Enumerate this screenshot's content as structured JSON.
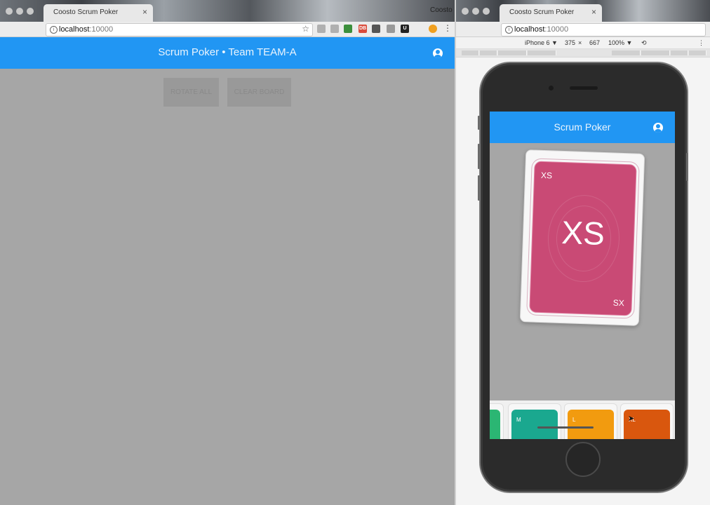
{
  "left_window": {
    "tab_title": "Coosto Scrum Poker",
    "profile_name": "Coosto",
    "url_host": "localhost",
    "url_port": ":10000",
    "app_title": "Scrum Poker • Team TEAM-A",
    "buttons": {
      "rotate_all": "ROTATE ALL",
      "clear_board": "CLEAR BOARD"
    },
    "extensions": [
      "DB",
      "U"
    ]
  },
  "right_window": {
    "tab_title": "Coosto Scrum Poker",
    "url_host": "localhost",
    "url_port": ":10000",
    "device_bar": {
      "device": "iPhone 6 ▼",
      "width": "375",
      "times": "×",
      "height": "667",
      "zoom": "100% ▼"
    },
    "mobile_app": {
      "title": "Scrum Poker",
      "selected_card": {
        "value": "XS",
        "corner_top": "XS",
        "corner_bottom": "SX",
        "color": "#c94a75"
      },
      "tray_cards": [
        {
          "label": "",
          "color": "#2bb673"
        },
        {
          "label": "M",
          "color": "#1aa88f"
        },
        {
          "label": "L",
          "color": "#f29b0f"
        },
        {
          "label": "XL",
          "color": "#d9570e"
        }
      ]
    }
  },
  "colors": {
    "header_blue": "#2196f3",
    "overlay_gray": "#a6a6a6"
  }
}
